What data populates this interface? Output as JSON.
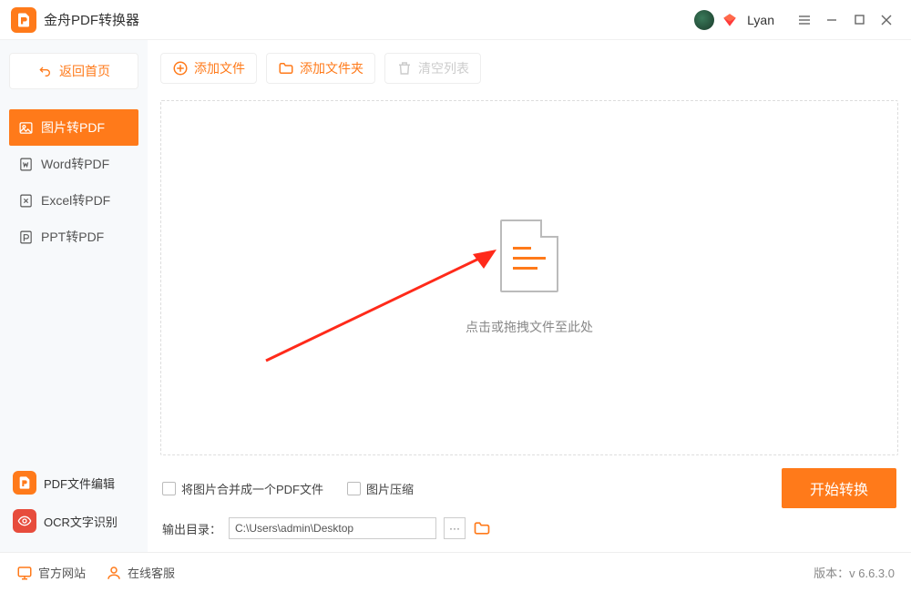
{
  "app": {
    "title": "金舟PDF转换器",
    "username": "Lyan"
  },
  "sidebar": {
    "back": "返回首页",
    "items": [
      {
        "label": "图片转PDF"
      },
      {
        "label": "Word转PDF"
      },
      {
        "label": "Excel转PDF"
      },
      {
        "label": "PPT转PDF"
      }
    ],
    "tools": [
      {
        "label": "PDF文件编辑"
      },
      {
        "label": "OCR文字识别"
      }
    ]
  },
  "toolbar": {
    "add_file": "添加文件",
    "add_folder": "添加文件夹",
    "clear": "清空列表"
  },
  "dropzone": {
    "hint": "点击或拖拽文件至此处"
  },
  "options": {
    "merge": "将图片合并成一个PDF文件",
    "compress": "图片压缩",
    "convert": "开始转换"
  },
  "output": {
    "label": "输出目录：",
    "path": "C:\\Users\\admin\\Desktop",
    "more": "···"
  },
  "footer": {
    "site": "官方网站",
    "support": "在线客服",
    "version": "版本：v 6.6.3.0"
  }
}
